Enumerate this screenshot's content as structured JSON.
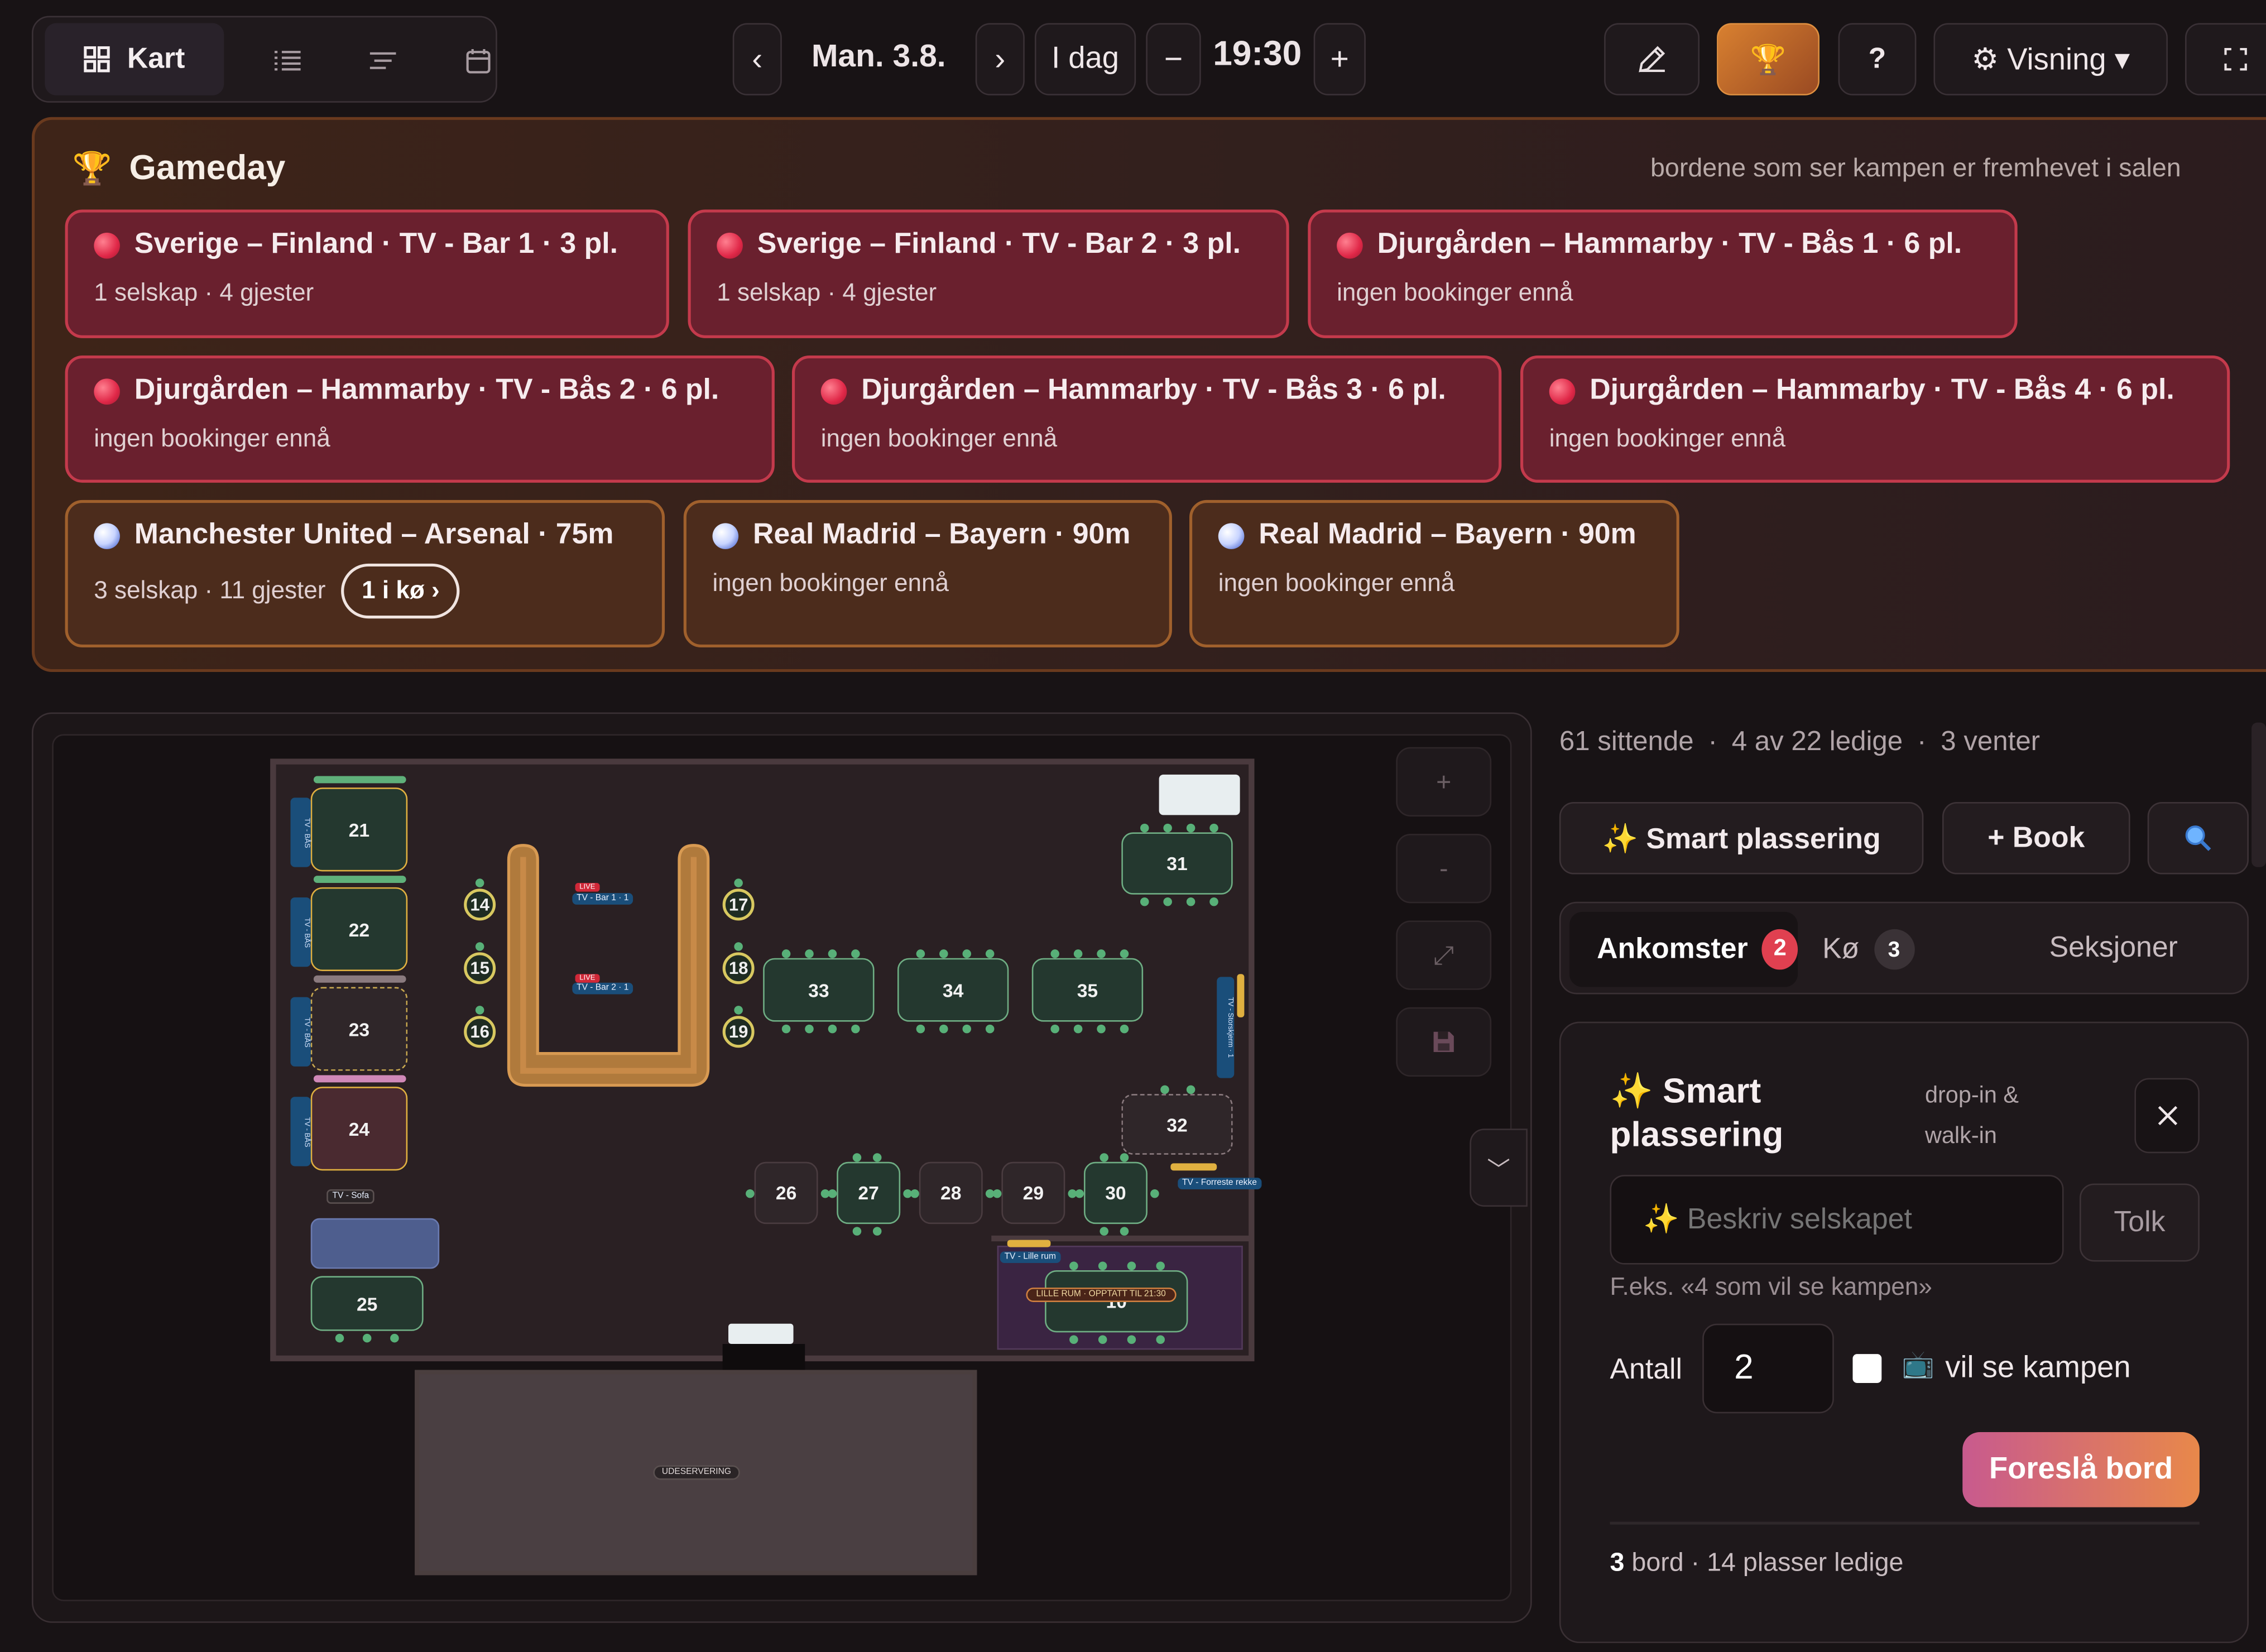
{
  "toolbar": {
    "view_tabs": [
      {
        "label": "Kart",
        "icon": "grid-icon",
        "active": true
      },
      {
        "label": "",
        "icon": "list-icon"
      },
      {
        "label": "",
        "icon": "timeline-icon"
      },
      {
        "label": "",
        "icon": "calendar-icon"
      }
    ],
    "date": "Man. 3.8.",
    "prev": "‹",
    "next": "›",
    "today": "I dag",
    "minus": "−",
    "time": "19:30",
    "plus": "+",
    "help": "?",
    "view_menu": "⚙ Visning ▾",
    "accent": "#c96a26"
  },
  "gameday": {
    "title": "Gameday",
    "hint": "bordene som ser kampen er fremhevet i salen",
    "cards": [
      {
        "title": "Sverige – Finland · TV  -  Bar 1 · 3 pl.",
        "sub": "1 selskap · 4 gjester",
        "kind": "tv"
      },
      {
        "title": "Sverige – Finland · TV  -  Bar 2 · 3 pl.",
        "sub": "1 selskap · 4 gjester",
        "kind": "tv"
      },
      {
        "title": "Djurgården – Hammarby · TV  -  Bås 1 · 6 pl.",
        "sub": "ingen bookinger ennå",
        "kind": "tv"
      },
      {
        "title": "Djurgården – Hammarby · TV  -  Bås 2 · 6 pl.",
        "sub": "ingen bookinger ennå",
        "kind": "tv"
      },
      {
        "title": "Djurgården – Hammarby · TV  -  Bås 3 · 6 pl.",
        "sub": "ingen bookinger ennå",
        "kind": "tv"
      },
      {
        "title": "Djurgården – Hammarby · TV  -  Bås 4 · 6 pl.",
        "sub": "ingen bookinger ennå",
        "kind": "tv"
      },
      {
        "title": "Manchester United – Arsenal · 75m",
        "sub": "3 selskap · 11 gjester",
        "queue": "1 i kø ›",
        "kind": "fb"
      },
      {
        "title": "Real Madrid – Bayern · 90m",
        "sub": "ingen bookinger ennå",
        "kind": "fb"
      },
      {
        "title": "Real Madrid – Bayern · 90m",
        "sub": "ingen bookinger ennå",
        "kind": "fb"
      }
    ]
  },
  "floor": {
    "booths": [
      "21",
      "22",
      "23",
      "24",
      "25"
    ],
    "round_tables": [
      "14",
      "15",
      "16",
      "17",
      "18",
      "19"
    ],
    "long_tables": [
      "33",
      "34",
      "35"
    ],
    "corner_tables": [
      "31",
      "32"
    ],
    "row_tables": [
      "26",
      "27",
      "28",
      "29",
      "30"
    ],
    "tv_labels": {
      "bar1": "TV - Bar 1 · 1",
      "bar2": "TV - Bar 2 · 1",
      "sofa": "TV - Sofa",
      "side": "TV - Storskjerm · 1",
      "front": "TV - Forreste rekke",
      "lille": "TV - Lille rum"
    },
    "live": "LIVE",
    "lille_rum": "LILLE RUM · OPPTATT TIL 21:30",
    "lille_num": "10",
    "outdoor": "UDESERVERING",
    "booth_tag": "TV - BÅS",
    "seat_tag": "#2"
  },
  "map_controls": {
    "zoom_in": "+",
    "zoom_out": "-",
    "fit": "⤢",
    "save": "save-icon",
    "collapse": "﹀"
  },
  "sidebar": {
    "stats": [
      "61 sittende",
      "4 av 22 ledige",
      "3 venter"
    ],
    "sep": "·",
    "smart_btn": "✨ Smart plassering",
    "book_btn": "+ Book",
    "tabs": {
      "arrivals": "Ankomster",
      "arrivals_count": "2",
      "queue": "Kø",
      "queue_count": "3",
      "sections": "Seksjoner"
    },
    "smart": {
      "title": "✨ Smart plassering",
      "subtitle": "drop-in & walk-in",
      "placeholder": "✨ Beskriv selskapet",
      "interpret": "Tolk",
      "example": "F.eks. «4 som vil se kampen»",
      "count_label": "Antall",
      "count_value": "2",
      "watch_label": "vil se kampen",
      "suggest": "Foreslå bord",
      "result_count": "3",
      "result_text": "bord · 14 plasser ledige"
    }
  }
}
